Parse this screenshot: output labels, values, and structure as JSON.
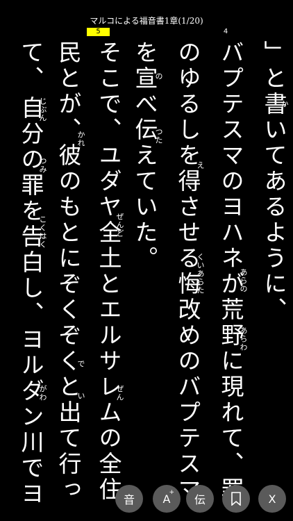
{
  "header": {
    "title": "マルコによる福音書1章(1/20)",
    "current_page": "5",
    "next_page": "4",
    "progress": 0.15
  },
  "text": {
    "columns": [
      "」と書いてあるように、",
      "バプテスマのヨハネが荒野に現れて、罪",
      "のゆるしを得させる悔改めのバプテスマ",
      "を宣べ伝えていた。",
      "そこで、ユダヤ全土とエルサレムの全住",
      "民とが、彼のもとにぞくぞくと出て行っ",
      "て、",
      "自分の罪を告白し、ヨルダン川でヨ"
    ],
    "ruby": {
      "kaki": "か",
      "arano": "あらの",
      "araware": "あらわ",
      "e": "え",
      "kuiaratame": "くいあらた",
      "no": "の",
      "tsuta": "つた",
      "zendo": "ぜんど",
      "zen": "ぜん",
      "kare": "かれ",
      "de": "で",
      "i": "い",
      "jibun": "じぶん",
      "tsumi": "つみ",
      "kokuhaku": "こくはく",
      "gawa": "がわ"
    }
  },
  "toolbar": {
    "audio_label": "音",
    "font_label": "A",
    "font_sup": "+",
    "tradition_label": "伝",
    "close_label": "X"
  },
  "colors": {
    "background": "#000000",
    "text": "#ffffff",
    "progress": "#ffff00",
    "button": "#5a5a5a"
  }
}
